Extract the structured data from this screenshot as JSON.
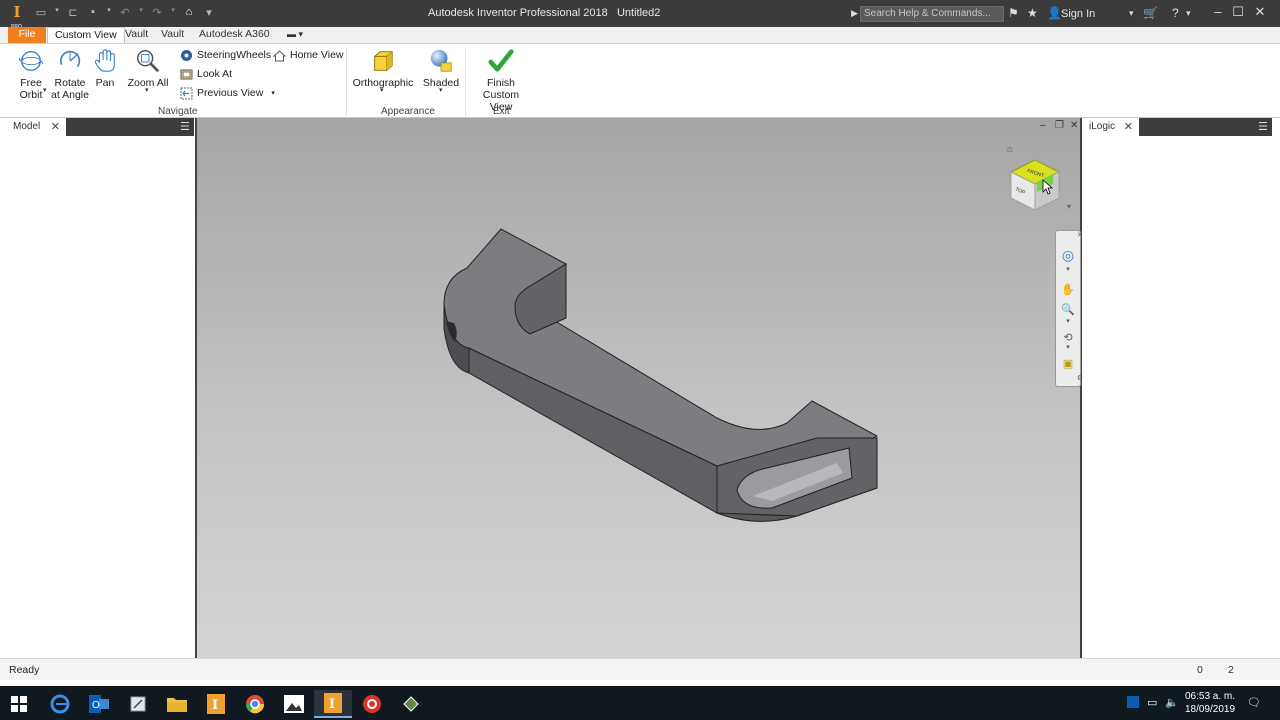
{
  "window": {
    "app_title": "Autodesk Inventor Professional 2018",
    "document": "Untitled2",
    "logo_letter": "I",
    "logo_sub": "PRO",
    "search_placeholder": "Search Help & Commands...",
    "sign_in": "Sign In"
  },
  "ribbon_tabs": {
    "file": "File",
    "custom_view": "Custom View",
    "vault1": "Vault",
    "vault2": "Vault",
    "a360": "Autodesk A360"
  },
  "ribbon": {
    "free_orbit_1": "Free",
    "free_orbit_2": "Orbit",
    "rotate_1": "Rotate",
    "rotate_2": "at Angle",
    "pan": "Pan",
    "zoom_all": "Zoom All",
    "steering_wheels": "SteeringWheels",
    "home_view": "Home View",
    "look_at": "Look At",
    "previous_view": "Previous View",
    "navigate": "Navigate",
    "orthographic": "Orthographic",
    "shaded": "Shaded",
    "appearance": "Appearance",
    "finish_1": "Finish Custom",
    "finish_2": "View",
    "exit": "Exit"
  },
  "panels": {
    "model_tab": "Model",
    "ilogic_tab": "iLogic"
  },
  "viewcube": {
    "front": "FRONT",
    "top": "TOP"
  },
  "status": {
    "text": "Ready",
    "count1": "0",
    "count2": "2"
  },
  "taskbar": {
    "time": "06:53 a. m.",
    "date": "18/09/2019"
  },
  "colors": {
    "title_bar": "#3b3b3b",
    "file_tab": "#f07f1e",
    "part_shade": "#6e6e72",
    "viewcube": "#d8e020"
  }
}
